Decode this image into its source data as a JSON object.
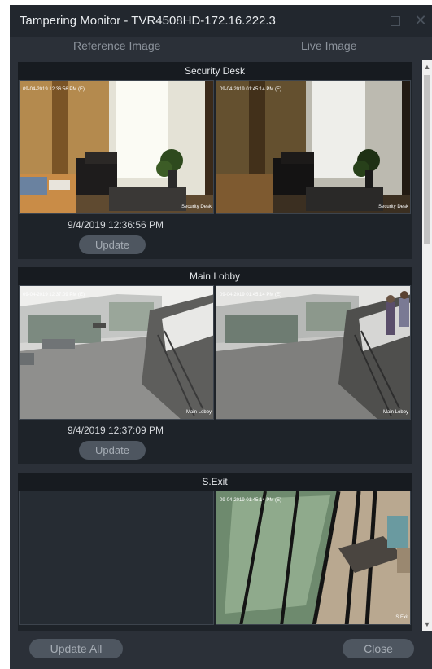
{
  "window": {
    "title": "Tampering Monitor - TVR4508HD-172.16.222.3"
  },
  "columns": {
    "reference": "Reference Image",
    "live": "Live Image"
  },
  "cameras": [
    {
      "name": "Security Desk",
      "ref_overlay": "09-04-2019 12:36:56 PM (E)",
      "live_overlay": "09-04-2019 01:45:14 PM (E)",
      "caption": "Security Desk",
      "timestamp": "9/4/2019 12:36:56 PM",
      "update_label": "Update"
    },
    {
      "name": "Main Lobby",
      "ref_overlay": "09-04-2019 12:37:09 PM (E)",
      "live_overlay": "09-04-2019 01:45:14 PM (E)",
      "caption": "Main Lobby",
      "timestamp": "9/4/2019 12:37:09 PM",
      "update_label": "Update"
    },
    {
      "name": "S.Exit",
      "live_overlay": "09-04-2019 01:45:14 PM (E)",
      "caption": "S.Exit"
    }
  ],
  "footer": {
    "update_all_label": "Update All",
    "close_label": "Close"
  },
  "icons": {
    "maximize": "maximize-icon",
    "close": "close-icon",
    "scroll_up": "chevron-up-icon",
    "scroll_down": "chevron-down-icon"
  },
  "colors": {
    "window_bg": "#2b3038",
    "titlebar_bg": "#22272e",
    "panel_bg": "#1e2329",
    "button_bg": "#4e5660"
  }
}
